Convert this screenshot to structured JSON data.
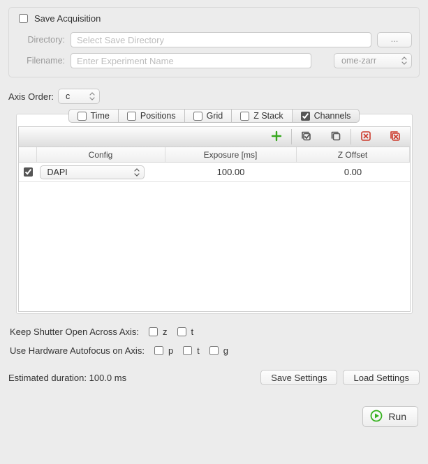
{
  "save_panel": {
    "save_acquisition_label": "Save Acquisition",
    "save_acquisition_checked": false,
    "directory_label": "Directory:",
    "directory_placeholder": "Select Save Directory",
    "browse_label": "...",
    "filename_label": "Filename:",
    "filename_placeholder": "Enter Experiment Name",
    "format_selected": "ome-zarr"
  },
  "axis_order": {
    "label": "Axis Order:",
    "value": "c"
  },
  "tabs": [
    {
      "id": "time",
      "label": "Time",
      "checked": false
    },
    {
      "id": "positions",
      "label": "Positions",
      "checked": false
    },
    {
      "id": "grid",
      "label": "Grid",
      "checked": false
    },
    {
      "id": "zstack",
      "label": "Z Stack",
      "checked": false
    },
    {
      "id": "channels",
      "label": "Channels",
      "checked": true
    }
  ],
  "channels_table": {
    "headers": {
      "config": "Config",
      "exposure": "Exposure [ms]",
      "zoffset": "Z Offset"
    },
    "rows": [
      {
        "checked": true,
        "config": "DAPI",
        "exposure": "100.00",
        "zoffset": "0.00"
      }
    ]
  },
  "shutter": {
    "label": "Keep Shutter Open Across Axis:",
    "axes": [
      {
        "id": "z",
        "label": "z",
        "checked": false
      },
      {
        "id": "t",
        "label": "t",
        "checked": false
      }
    ]
  },
  "autofocus": {
    "label": "Use Hardware Autofocus on Axis:",
    "axes": [
      {
        "id": "p",
        "label": "p",
        "checked": false
      },
      {
        "id": "t",
        "label": "t",
        "checked": false
      },
      {
        "id": "g",
        "label": "g",
        "checked": false
      }
    ]
  },
  "estimated_duration": "Estimated duration: 100.0 ms",
  "buttons": {
    "save_settings": "Save Settings",
    "load_settings": "Load Settings",
    "run": "Run"
  }
}
